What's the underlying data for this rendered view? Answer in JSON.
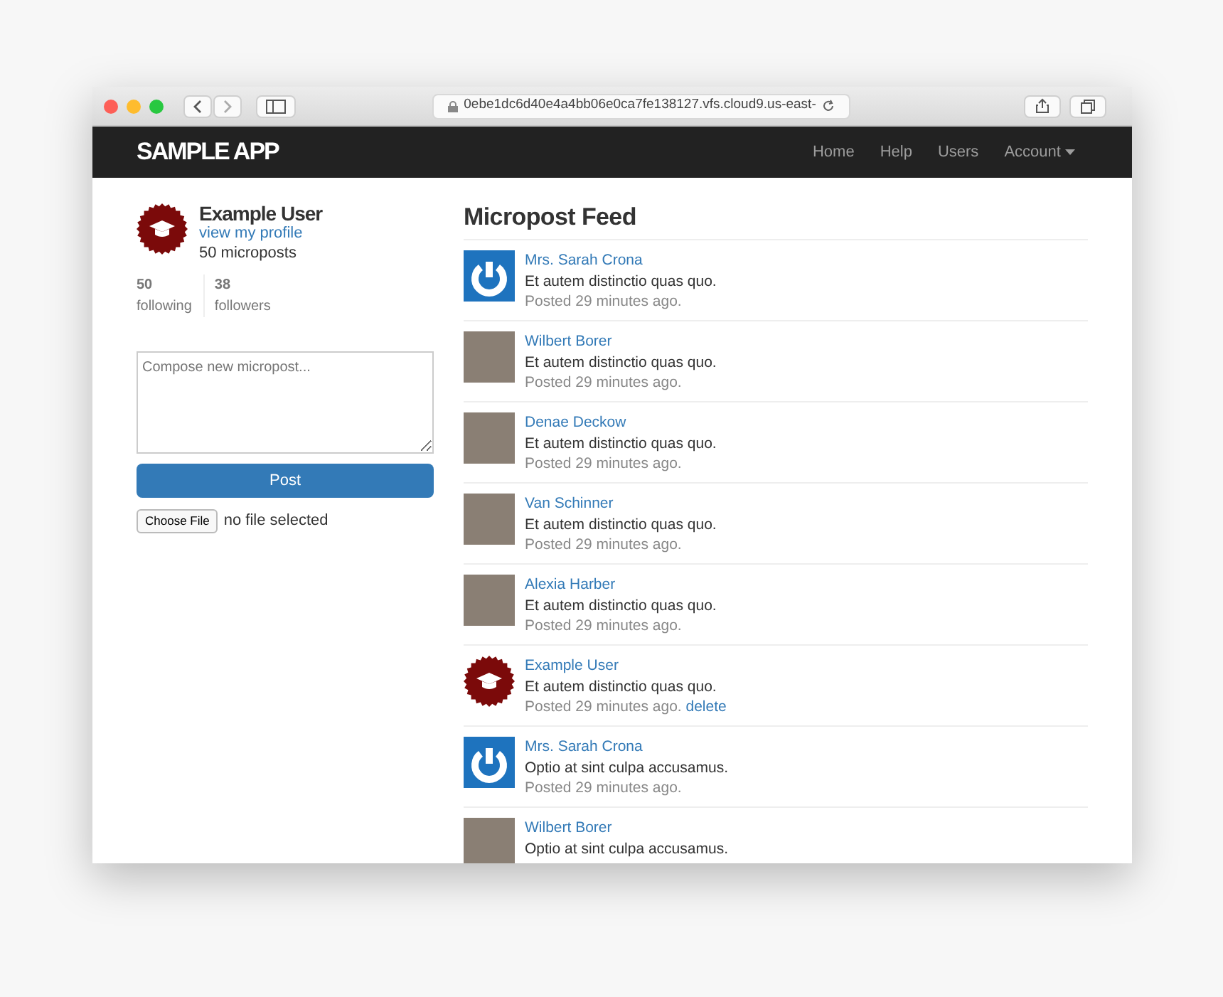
{
  "browser": {
    "url": "0ebe1dc6d40e4a4bb06e0ca7fe138127.vfs.cloud9.us-east-"
  },
  "navbar": {
    "brand": "SAMPLE APP",
    "links": [
      {
        "label": "Home",
        "dropdown": false
      },
      {
        "label": "Help",
        "dropdown": false
      },
      {
        "label": "Users",
        "dropdown": false
      },
      {
        "label": "Account",
        "dropdown": true
      }
    ]
  },
  "profile": {
    "name": "Example User",
    "link": "view my profile",
    "microposts": "50 microposts",
    "stats": [
      {
        "count": "50",
        "label": "following"
      },
      {
        "count": "38",
        "label": "followers"
      }
    ]
  },
  "composer": {
    "placeholder": "Compose new micropost...",
    "button": "Post",
    "file_button": "Choose File",
    "file_status": "no file selected"
  },
  "feed": {
    "title": "Micropost Feed",
    "posts": [
      {
        "kind": "logo",
        "user": "Mrs. Sarah Crona",
        "content": "Et autem distinctio quas quo.",
        "time": "Posted 29 minutes ago."
      },
      {
        "kind": "photo",
        "user": "Wilbert Borer",
        "content": "Et autem distinctio quas quo.",
        "time": "Posted 29 minutes ago."
      },
      {
        "kind": "photo",
        "user": "Denae Deckow",
        "content": "Et autem distinctio quas quo.",
        "time": "Posted 29 minutes ago."
      },
      {
        "kind": "photo",
        "user": "Van Schinner",
        "content": "Et autem distinctio quas quo.",
        "time": "Posted 29 minutes ago."
      },
      {
        "kind": "photo",
        "user": "Alexia Harber",
        "content": "Et autem distinctio quas quo.",
        "time": "Posted 29 minutes ago."
      },
      {
        "kind": "badge",
        "user": "Example User",
        "content": "Et autem distinctio quas quo.",
        "time": "Posted 29 minutes ago.",
        "delete": "delete"
      },
      {
        "kind": "logo",
        "user": "Mrs. Sarah Crona",
        "content": "Optio at sint culpa accusamus.",
        "time": "Posted 29 minutes ago."
      },
      {
        "kind": "photo",
        "user": "Wilbert Borer",
        "content": "Optio at sint culpa accusamus."
      }
    ]
  }
}
